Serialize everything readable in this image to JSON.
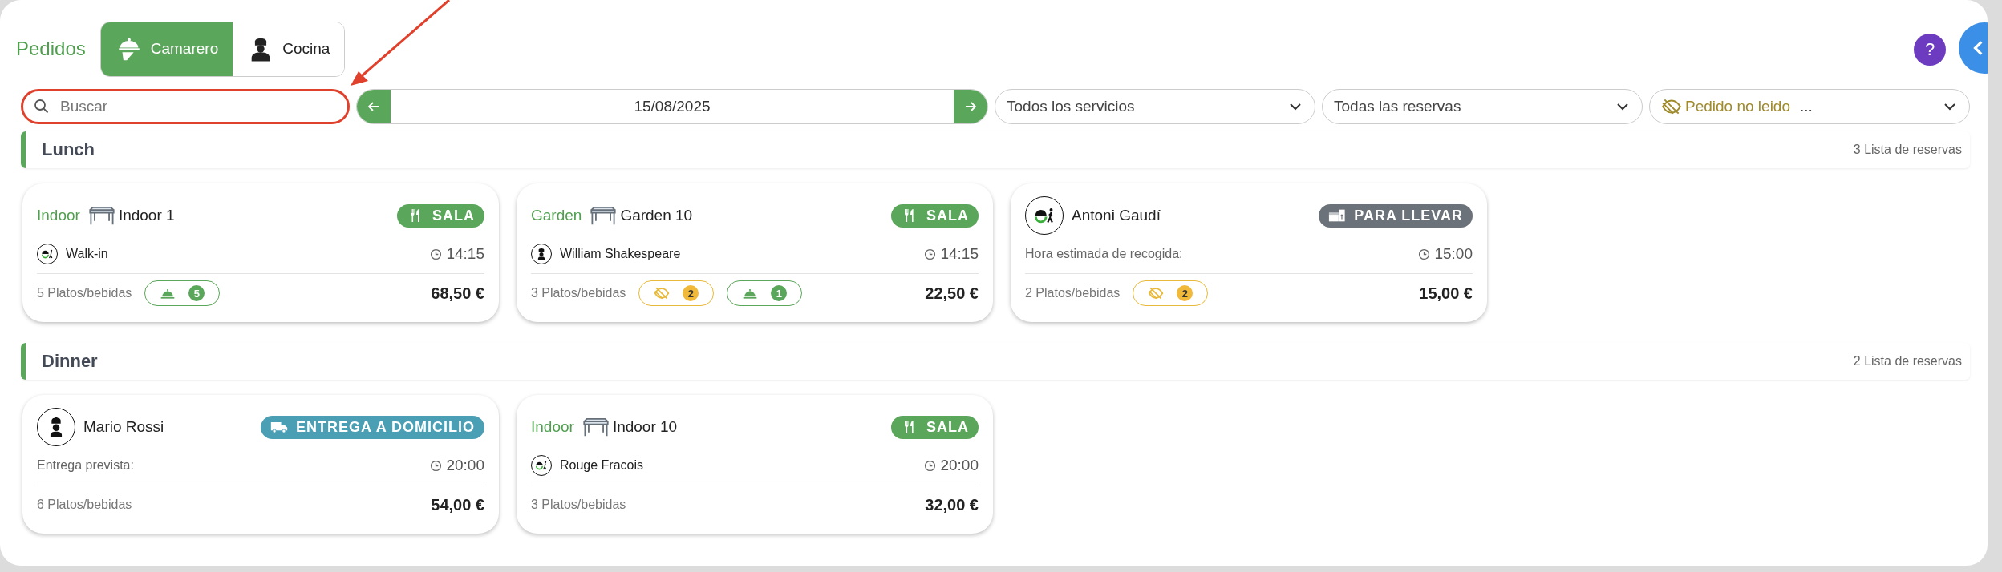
{
  "header": {
    "title": "Pedidos",
    "roles": [
      {
        "label": "Camarero",
        "kind": "waiter",
        "selected": true
      },
      {
        "label": "Cocina",
        "kind": "chef",
        "selected": false
      }
    ],
    "help": "?"
  },
  "search": {
    "placeholder": "Buscar",
    "highlighted": true
  },
  "date": "15/08/2025",
  "filters": [
    {
      "label": "Todos los servicios",
      "kind": "plain"
    },
    {
      "label": "Todas las reservas",
      "kind": "plain"
    },
    {
      "label": "Pedido no leido",
      "extra": "...",
      "kind": "unread"
    }
  ],
  "sections": [
    {
      "title": "Lunch",
      "count": "3 Lista de reservas",
      "orders": [
        {
          "kind": "dine_in",
          "zone": "Indoor",
          "table": "Indoor 1",
          "badge": "SALA",
          "customer": "Walk-in",
          "avatar": {
            "kind": "walkin"
          },
          "time": "14:15",
          "items": "5 Platos/bebidas",
          "chips": [
            {
              "kind": "ready",
              "count": "5"
            }
          ],
          "total": "68,50 €"
        },
        {
          "kind": "dine_in",
          "zone": "Garden",
          "table": "Garden 10",
          "badge": "SALA",
          "customer": "William Shakespeare",
          "avatar": {
            "kind": "chef"
          },
          "time": "14:15",
          "items": "3 Platos/bebidas",
          "chips": [
            {
              "kind": "unread",
              "count": "2"
            },
            {
              "kind": "ready",
              "count": "1"
            }
          ],
          "total": "22,50 €"
        },
        {
          "kind": "takeaway",
          "badge": "PARA LLEVAR",
          "customer": "Antoni Gaudí",
          "avatar": {
            "kind": "walkin"
          },
          "time_label": "Hora estimada de recogida:",
          "time": "15:00",
          "items": "2 Platos/bebidas",
          "chips": [
            {
              "kind": "unread",
              "count": "2"
            }
          ],
          "total": "15,00 €"
        }
      ]
    },
    {
      "title": "Dinner",
      "count": "2 Lista de reservas",
      "orders": [
        {
          "kind": "delivery",
          "badge": "ENTREGA A DOMICILIO",
          "customer": "Mario Rossi",
          "avatar": {
            "kind": "chef"
          },
          "time_label": "Entrega prevista:",
          "time": "20:00",
          "items": "6 Platos/bebidas",
          "total": "54,00 €"
        },
        {
          "kind": "dine_in",
          "zone": "Indoor",
          "table": "Indoor 10",
          "badge": "SALA",
          "customer": "Rouge Fracois",
          "avatar": {
            "kind": "walkin"
          },
          "time": "20:00",
          "items": "3 Platos/bebidas",
          "total": "32,00 €"
        }
      ]
    }
  ]
}
